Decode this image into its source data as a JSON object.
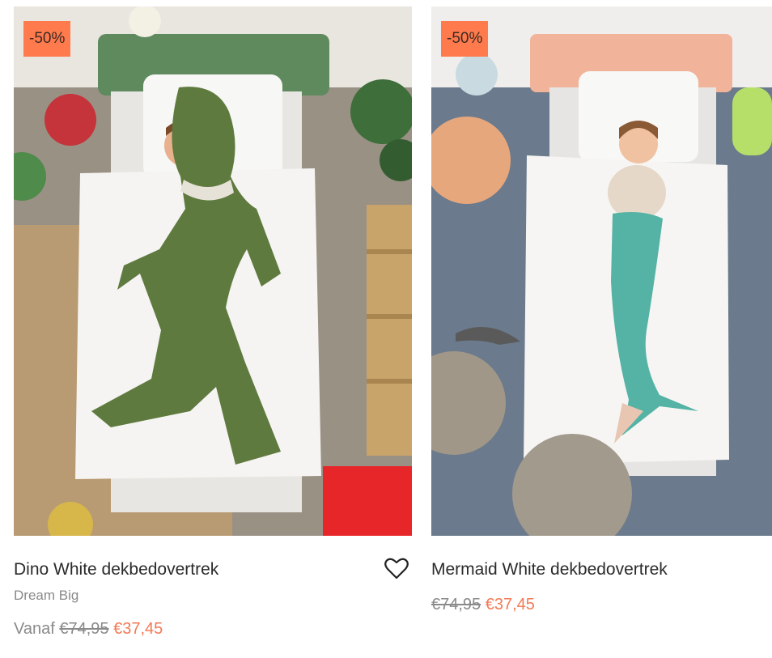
{
  "products": [
    {
      "badge": "-50%",
      "title": "Dino White dekbedovertrek",
      "brand": "Dream Big",
      "price_prefix": "Vanaf",
      "old_price": "€74,95",
      "new_price": "€37,45"
    },
    {
      "badge": "-50%",
      "title": "Mermaid White dekbedovertrek",
      "old_price": "€74,95",
      "new_price": "€37,45"
    }
  ],
  "colors": {
    "badge_bg": "#ff7a4d",
    "sale_price": "#f37a55",
    "muted_text": "#8a8a8a",
    "title_text": "#2b2b2b"
  }
}
